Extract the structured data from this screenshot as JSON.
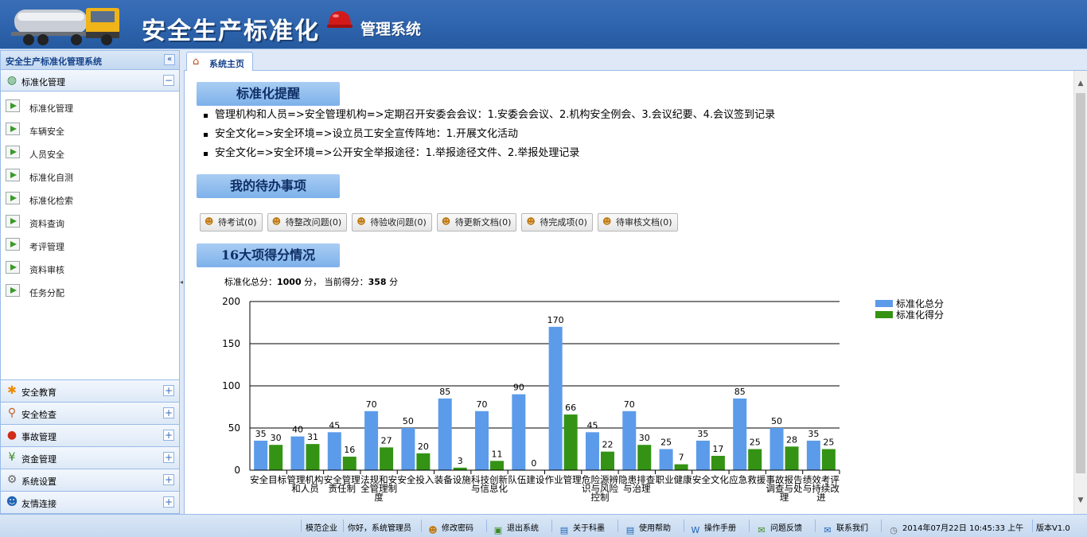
{
  "header": {
    "title": "安全生产标准化",
    "subtitle": "管理系统"
  },
  "sidebar": {
    "title": "安全生产标准化管理系统",
    "active_group": {
      "label": "标准化管理",
      "icon": "globe-icon"
    },
    "items": [
      {
        "label": "标准化管理",
        "icon": "arrow-right-icon"
      },
      {
        "label": "车辆安全",
        "icon": "arrow-right-icon"
      },
      {
        "label": "人员安全",
        "icon": "arrow-right-icon"
      },
      {
        "label": "标准化自测",
        "icon": "arrow-right-icon"
      },
      {
        "label": "标准化检索",
        "icon": "arrow-right-icon"
      },
      {
        "label": "资料查询",
        "icon": "arrow-right-icon"
      },
      {
        "label": "考评管理",
        "icon": "arrow-right-icon"
      },
      {
        "label": "资料审核",
        "icon": "arrow-right-icon"
      },
      {
        "label": "任务分配",
        "icon": "arrow-right-icon"
      }
    ],
    "groups": [
      {
        "label": "安全教育",
        "icon": "star-icon",
        "color": "#f08a00"
      },
      {
        "label": "安全检查",
        "icon": "magnifier-icon",
        "color": "#c0622a"
      },
      {
        "label": "事故管理",
        "icon": "alert-icon",
        "color": "#d12b1b"
      },
      {
        "label": "资金管理",
        "icon": "yen-icon",
        "color": "#3b8a23"
      },
      {
        "label": "系统设置",
        "icon": "gear-icon",
        "color": "#666666"
      },
      {
        "label": "友情连接",
        "icon": "users-icon",
        "color": "#1f63b5"
      }
    ]
  },
  "tabs": {
    "home": "系统主页"
  },
  "reminder": {
    "title": "标准化提醒",
    "items": [
      "管理机构和人员=>安全管理机构=>定期召开安委会会议：1.安委会会议、2.机构安全例会、3.会议纪要、4.会议签到记录",
      "安全文化=>安全环境=>设立员工安全宣传阵地：1.开展文化活动",
      "安全文化=>安全环境=>公开安全举报途径：1.举报途径文件、2.举报处理记录"
    ]
  },
  "todo": {
    "title": "我的待办事项",
    "buttons": [
      "待考试(0)",
      "待整改问题(0)",
      "待验收问题(0)",
      "待更新文档(0)",
      "待完成项(0)",
      "待审核文档(0)"
    ]
  },
  "scores": {
    "title": "16大项得分情况",
    "total_label": "标准化总分：",
    "total_value": "1000",
    "unit": "分",
    "current_label": "当前得分：",
    "current_value": "358"
  },
  "chart_data": {
    "type": "bar",
    "categories": [
      "安全目标",
      "管理机构和人员",
      "安全管理责任制",
      "法规和安全管理制度",
      "安全投入",
      "装备设施",
      "科技创新与信息化",
      "队伍建设",
      "作业管理",
      "危险源辨识与风险控制",
      "隐患排查与治理",
      "职业健康",
      "安全文化",
      "应急救援",
      "事故报告调查与处理",
      "绩效考评与持续改进"
    ],
    "series": [
      {
        "name": "标准化总分",
        "color": "#5b9bea",
        "values": [
          35,
          40,
          45,
          70,
          50,
          85,
          70,
          90,
          170,
          45,
          70,
          25,
          35,
          85,
          50,
          35
        ]
      },
      {
        "name": "标准化得分",
        "color": "#349314",
        "values": [
          30,
          31,
          16,
          27,
          20,
          3,
          11,
          0,
          66,
          22,
          30,
          7,
          17,
          25,
          28,
          25
        ]
      }
    ],
    "yticks": [
      0,
      50,
      100,
      150,
      200
    ],
    "ylim": [
      0,
      200
    ],
    "legend": "top-right",
    "grid": true
  },
  "statusbar": {
    "company": "模范企业",
    "greeting": "你好，系统管理员",
    "change_password": "修改密码",
    "logout": "退出系统",
    "about": "关于科墨",
    "help": "使用帮助",
    "manual": "操作手册",
    "feedback": "问题反馈",
    "contact": "联系我们",
    "datetime": "2014年07月22日 10:45:33 上午",
    "version": "版本V1.0"
  }
}
